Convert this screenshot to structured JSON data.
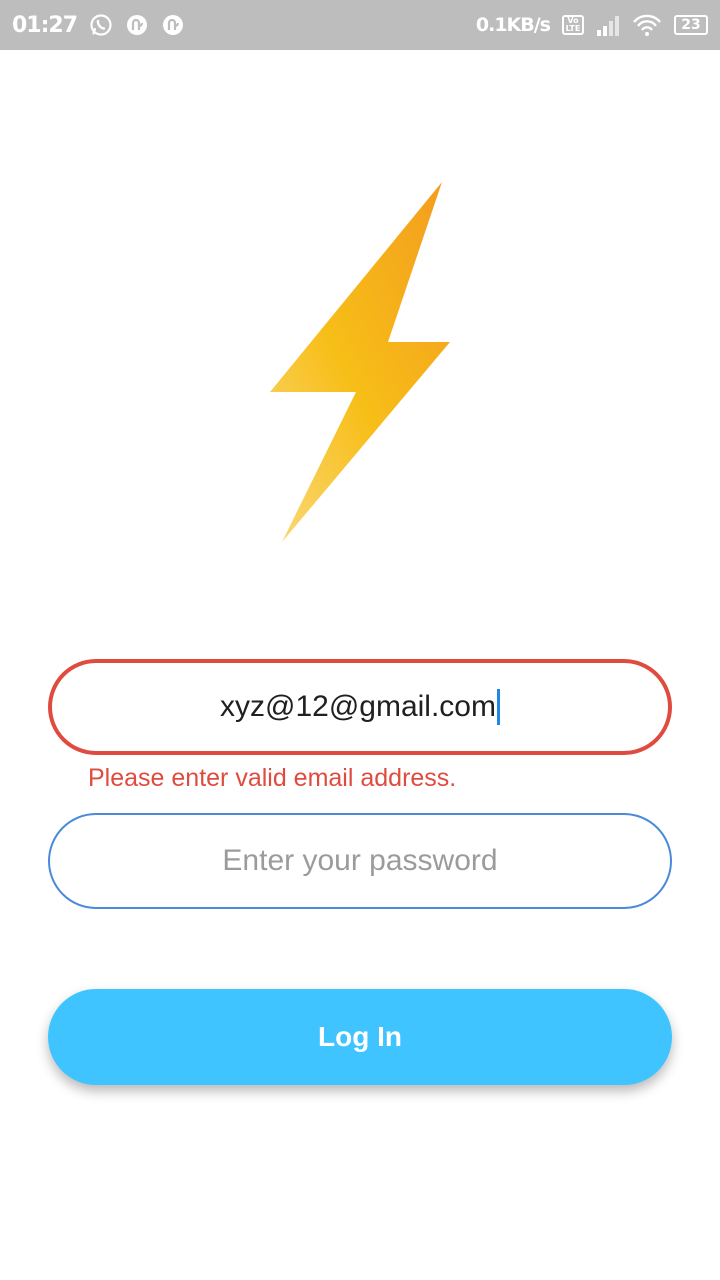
{
  "status_bar": {
    "time": "01:27",
    "network_speed": "0.1KB/s",
    "volte_label": "Vo LTE",
    "battery_level": "23",
    "left_icons": [
      "whatsapp-icon",
      "app-notification-icon",
      "app-notification-icon"
    ],
    "right_icons": [
      "volte-icon",
      "signal-icon",
      "wifi-icon",
      "battery-icon"
    ]
  },
  "logo": {
    "icon": "lightning-bolt-icon",
    "colors": {
      "top": "#f39c1f",
      "middle": "#f7be17",
      "bottom": "#fad97a"
    }
  },
  "login_form": {
    "email": {
      "value": "xyz@12@gmail.com",
      "error": "Please enter valid email address.",
      "border_color": "#e04b3f"
    },
    "password": {
      "placeholder": "Enter your password",
      "value": "",
      "border_color": "#4a8ad8"
    },
    "submit_label": "Log In",
    "submit_color": "#40c4ff"
  }
}
